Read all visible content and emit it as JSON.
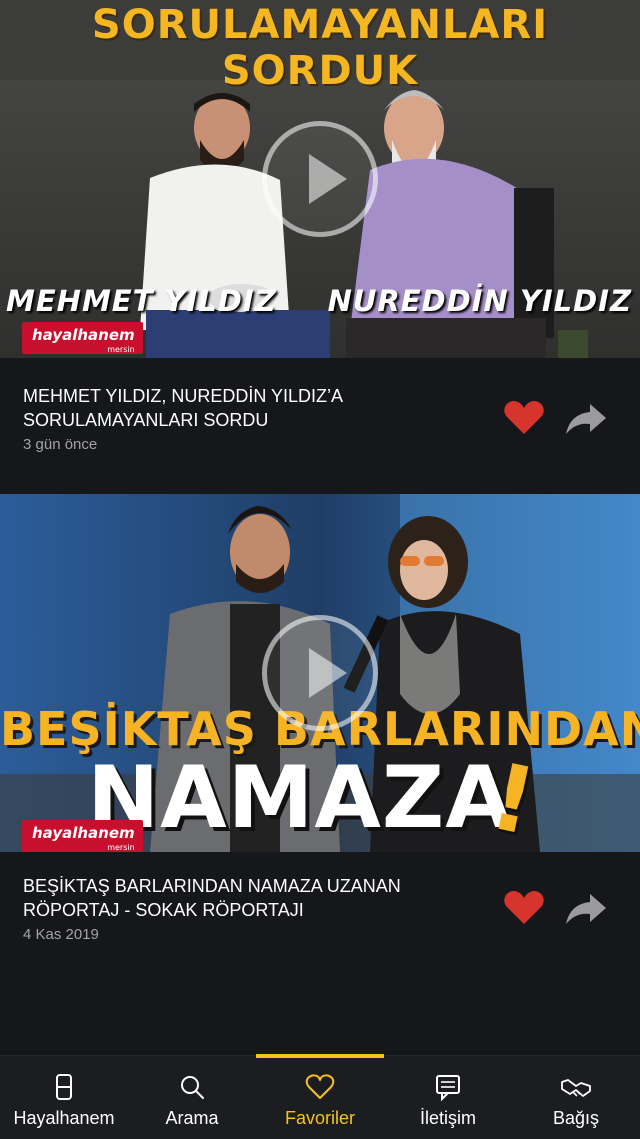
{
  "feed": {
    "videos": [
      {
        "title": "MEHMET YILDIZ, NUREDDİN YILDIZ’A SORULAMAYANLARI SORDU",
        "date": "3 gün önce",
        "thumbnail": {
          "headline_line1": "SORULAMAYANLARI",
          "headline_line2": "SORDUK",
          "name_left": "MEHMET YILDIZ",
          "name_right": "NUREDDİN YILDIZ",
          "brand": "hayalhanem",
          "brand_sub": "mersin"
        },
        "favorited": true
      },
      {
        "title": "BEŞİKTAŞ BARLARINDAN NAMAZA UZANAN RÖPORTAJ - SOKAK RÖPORTAJI",
        "date": "4 Kas 2019",
        "thumbnail": {
          "headline_line1": "BEŞİKTAŞ BARLARINDAN",
          "headline_line2": "NAMAZA",
          "headline_exclaim": "!",
          "brand": "hayalhanem",
          "brand_sub": "mersin"
        },
        "favorited": true
      }
    ]
  },
  "tabbar": {
    "tabs": [
      {
        "label": "Hayalhanem",
        "icon": "home-icon"
      },
      {
        "label": "Arama",
        "icon": "search-icon"
      },
      {
        "label": "Favoriler",
        "icon": "heart-icon",
        "active": true
      },
      {
        "label": "İletişim",
        "icon": "message-icon"
      },
      {
        "label": "Bağış",
        "icon": "handshake-icon"
      }
    ]
  },
  "colors": {
    "background": "#16171b",
    "accent": "#f6c21e",
    "favorite_heart": "#d6342c",
    "secondary_text": "#a3a3a8"
  }
}
